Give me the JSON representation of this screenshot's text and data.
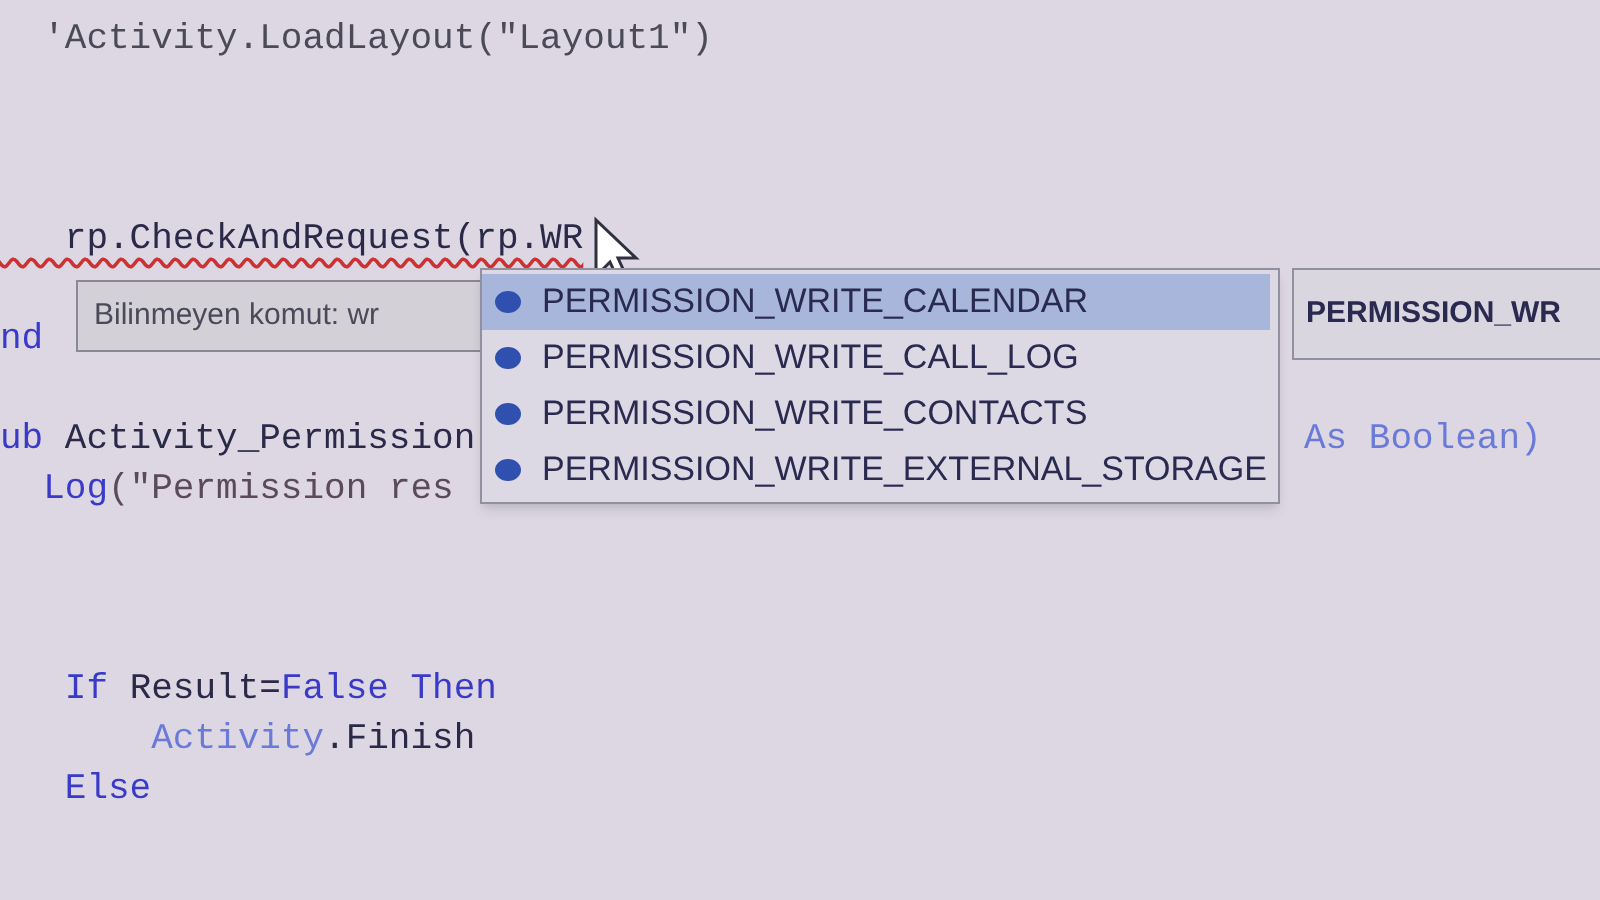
{
  "editor": {
    "lines": [
      {
        "kind": "code",
        "tokens": [
          {
            "t": "  'Activity.LoadLayout(\"Layout1\")",
            "kind": "comment"
          }
        ]
      },
      {
        "kind": "blank"
      },
      {
        "kind": "blank"
      },
      {
        "kind": "blank"
      },
      {
        "kind": "code",
        "error": true,
        "tokens": [
          {
            "t": "   rp.CheckAndRequest(rp.WR",
            "kind": "plain"
          }
        ]
      },
      {
        "kind": "blank"
      },
      {
        "kind": "code",
        "tokens": [
          {
            "t": "nd",
            "kind": "keyword"
          }
        ]
      },
      {
        "kind": "blank"
      },
      {
        "kind": "code",
        "tokens": [
          {
            "t": "ub ",
            "kind": "keyword"
          },
          {
            "t": "Activity_Permission",
            "kind": "plain"
          }
        ],
        "tail": [
          {
            "t": "As Boolean)",
            "kind": "type"
          }
        ]
      },
      {
        "kind": "code",
        "tokens": [
          {
            "t": "  Log",
            "kind": "keyword"
          },
          {
            "t": "(\"Permission res",
            "kind": "string"
          }
        ]
      },
      {
        "kind": "blank"
      },
      {
        "kind": "blank"
      },
      {
        "kind": "blank"
      },
      {
        "kind": "code",
        "tokens": [
          {
            "t": "   If ",
            "kind": "keyword"
          },
          {
            "t": "Result=",
            "kind": "plain"
          },
          {
            "t": "False ",
            "kind": "keyword"
          },
          {
            "t": "Then",
            "kind": "keyword"
          }
        ]
      },
      {
        "kind": "code",
        "tokens": [
          {
            "t": "       Activity",
            "kind": "type"
          },
          {
            "t": ".Finish",
            "kind": "plain"
          }
        ]
      },
      {
        "kind": "code",
        "tokens": [
          {
            "t": "   Else",
            "kind": "keyword"
          }
        ]
      }
    ]
  },
  "tooltip": {
    "text": "Bilinmeyen komut: wr"
  },
  "autocomplete": {
    "items": [
      {
        "label": "PERMISSION_WRITE_CALENDAR",
        "selected": true
      },
      {
        "label": "PERMISSION_WRITE_CALL_LOG",
        "selected": false
      },
      {
        "label": "PERMISSION_WRITE_CONTACTS",
        "selected": false
      },
      {
        "label": "PERMISSION_WRITE_EXTERNAL_STORAGE",
        "selected": false
      }
    ]
  },
  "description": {
    "title": "PERMISSION_WR"
  }
}
